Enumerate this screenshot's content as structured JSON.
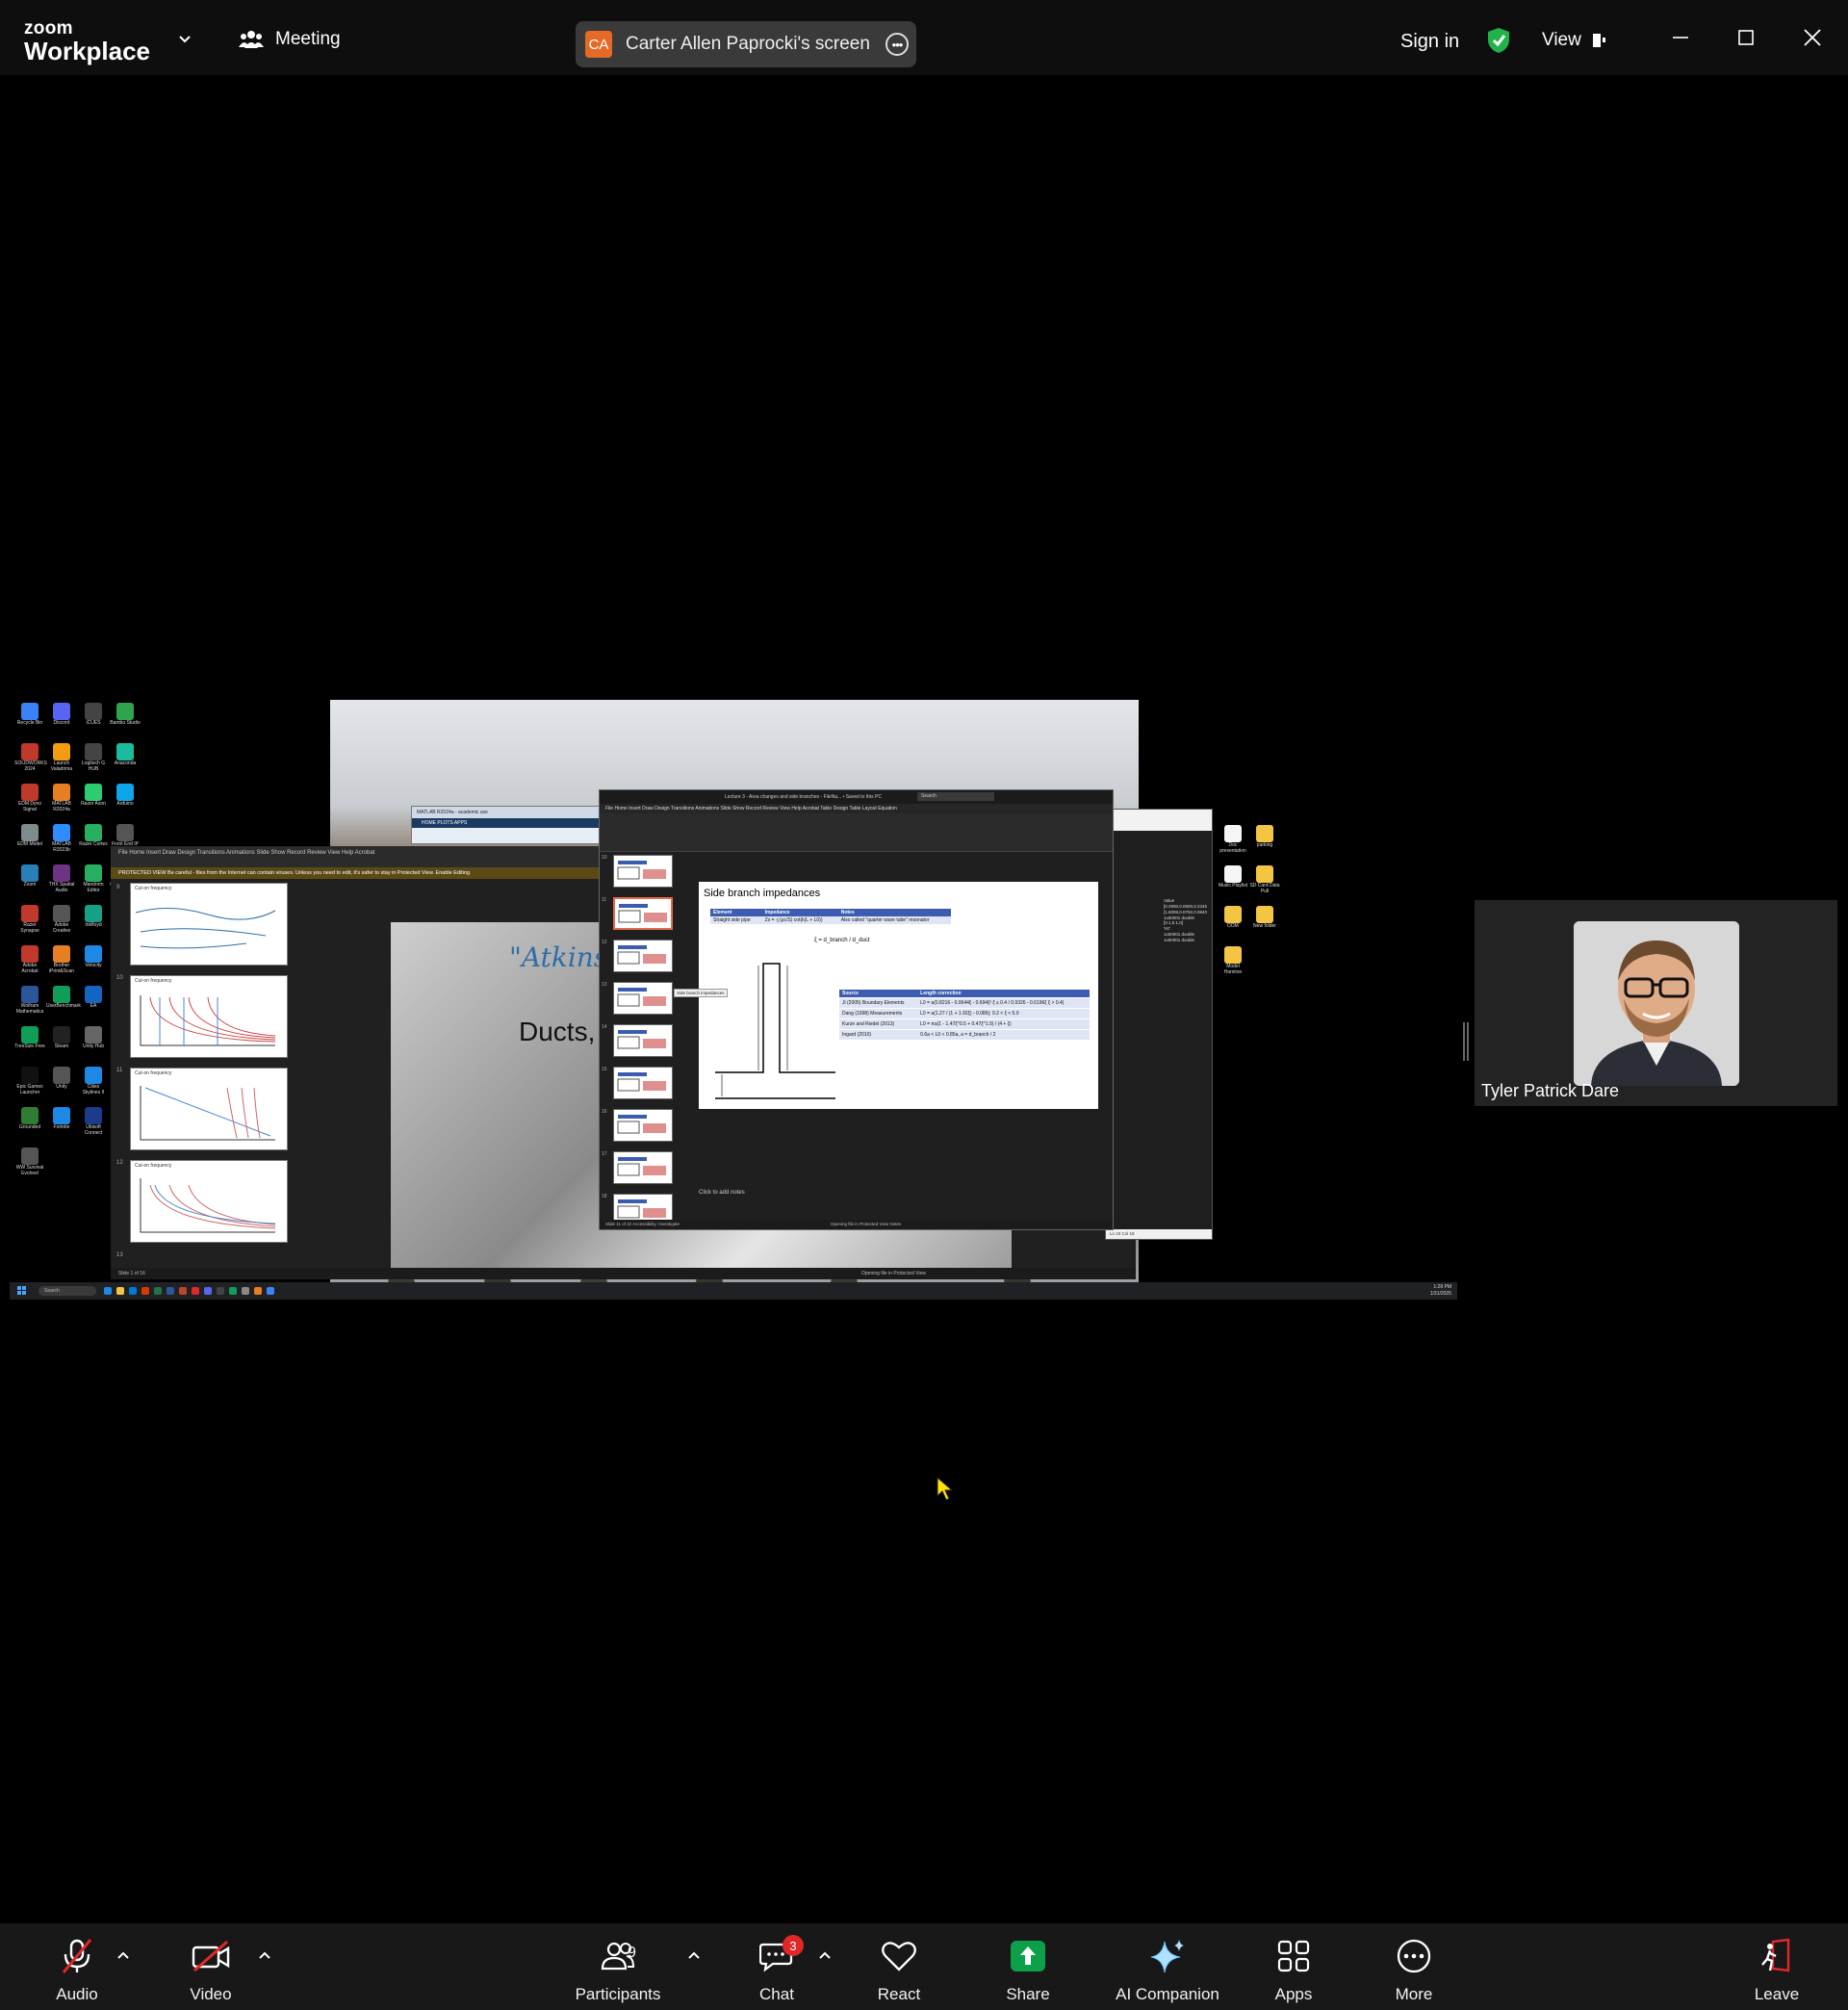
{
  "titlebar": {
    "logo_line1": "zoom",
    "logo_line2": "Workplace",
    "meeting_label": "Meeting",
    "share_initials": "CA",
    "share_label": "Carter Allen Paprocki's screen",
    "sign_in": "Sign in",
    "view_label": "View",
    "accent_color": "#e66a27",
    "shield_color": "#22b24c"
  },
  "shared_screen": {
    "back_ppt": {
      "menu": "File    Home    Insert    Draw    Design    Transitions    Animations    Slide Show    Record    Review    View    Help    Acrobat",
      "protected_view": "PROTECTED VIEW  Be careful - files from the Internet can contain viruses. Unless you need to edit, it's safer to stay in Protected View.   Enable Editing",
      "slide_handwriting": "\"Atkinson Hyp",
      "slide_title": "Ducts, l",
      "thumb_numbers": [
        "9",
        "10",
        "11",
        "12",
        "13"
      ],
      "thumb_titles": [
        "Cut-on frequency",
        "Cut-on frequency",
        "Cut-on frequency",
        "Cut-on frequency"
      ],
      "status_left": "Slide 1 of 16",
      "status_right": "Opening file in Protected View"
    },
    "matlab": {
      "title": "MATLAB R2024a - academic use",
      "tabs": "HOME    PLOTS    APPS"
    },
    "front_ppt": {
      "title": "Lecture 3 - Area changes and side branches - FileNa... • Saved to this PC",
      "search": "Search",
      "menu": "File  Home  Insert  Draw  Design  Transitions  Animations  Slide Show  Record  Review  View  Help  Acrobat  Table Design  Table Layout  Equation",
      "thumb_numbers": [
        "10",
        "11",
        "12",
        "13",
        "14",
        "15",
        "16",
        "17",
        "18"
      ],
      "slide_title": "Side branch impedances",
      "impedance_table": {
        "headers": [
          "Element",
          "Impedance",
          "Notes"
        ],
        "row": [
          "Straight side pipe",
          "Zs = -j (ρc/S) cot(k(L + L0))",
          "Also called \"quarter wave tube\" resonator"
        ]
      },
      "xi_formula": "ξ = d_branch / d_duct",
      "length_table": {
        "headers": [
          "Source",
          "Length correction"
        ],
        "rows": [
          [
            "Ji (2005) Boundary Elements",
            "L0 = a(0.8216 - 0.0644ξ - 0.694ξ²   ξ ≤ 0.4 / 0.9326 - 0.6196ξ   ξ > 0.4)"
          ],
          [
            "Dang (1998) Measurements",
            "L0 = a(1.27 / (1 + 1.92ξ) - 0.086);   0.2 < ξ < 5.0"
          ],
          [
            "Kurze and Riedel (2013)",
            "L0 = πa(1 - 1.47ξ^0.5 + 0.47ξ^1.5) / (4 + ξ)"
          ],
          [
            "Ingard (2010)",
            "0.6a < L0 < 0.85a,  a = d_branch / 2"
          ]
        ]
      },
      "notes_placeholder": "Click to add notes",
      "status_left": "Slide 11 of 22    Accessibility: Investigate",
      "status_right": "Opening file in Protected View    Notes",
      "tooltip": "Side branch impedances"
    },
    "notepad": {
      "rows": [
        "Value",
        "[0.2500,0.0500,0.2345",
        "[1.6006,0.0782,0.0840",
        "1x50001 double",
        "[0.1,0.1,0]",
        "'Hz'",
        "1x50001 double",
        "1x50001 double"
      ],
      "status": "Ln 10    Col 18"
    },
    "desktop_icons": [
      "Recycle Bin",
      "Discord",
      "iCUES",
      "Bambu Studio",
      "SOLIDWORKS 2024",
      "Launch Valadrima",
      "Logitech G HUB",
      "Anaconda",
      "EDM Dyno Signal",
      "MATLAB R2024a",
      "Razer Axon",
      "Arduino",
      "EDM Model",
      "MATLAB R2023b",
      "Razer Cortex",
      "Front End IP Address",
      "Zoom",
      "THX Spatial Audio",
      "Mandorm Editor",
      "CMDfiler Core",
      "Razer Synapse",
      "Adobe Creative",
      "Inkfloyd",
      "GeForce Experience",
      "Adobe Acrobat",
      "Brother iPrint&Scan",
      "Velocity",
      "Adobe Photoshop",
      "Wolfram Mathematica",
      "UserBenchmark",
      "EA",
      "Lightroom",
      "TreeSize Free",
      "Steam",
      "Unity Hub",
      "Google Play Games beta",
      "Epic Games Launcher",
      "Unity",
      "Cities Skylines II",
      "Xbox",
      "Grounded",
      "Fortnite",
      "Ubisoft Connect",
      "PC Building Simulator 2",
      "WW Survival Evolved"
    ],
    "right_icons": [
      "Doc presentation",
      "parking",
      "Music Playlist",
      "SD Card Data Pull",
      "DOM",
      "New folder",
      "Model Hamiton"
    ],
    "taskbar_search": "Search",
    "clock_time": "1:28 PM",
    "clock_date": "1/31/2025"
  },
  "participant": {
    "name": "Tyler Patrick Dare"
  },
  "toolbar": {
    "audio": "Audio",
    "video": "Video",
    "participants": "Participants",
    "participant_count": "9",
    "chat": "Chat",
    "chat_badge": "3",
    "react": "React",
    "share": "Share",
    "ai_companion": "AI Companion",
    "apps": "Apps",
    "more": "More",
    "leave": "Leave",
    "share_color": "#0e9f4a",
    "muted_color": "#e02828"
  }
}
